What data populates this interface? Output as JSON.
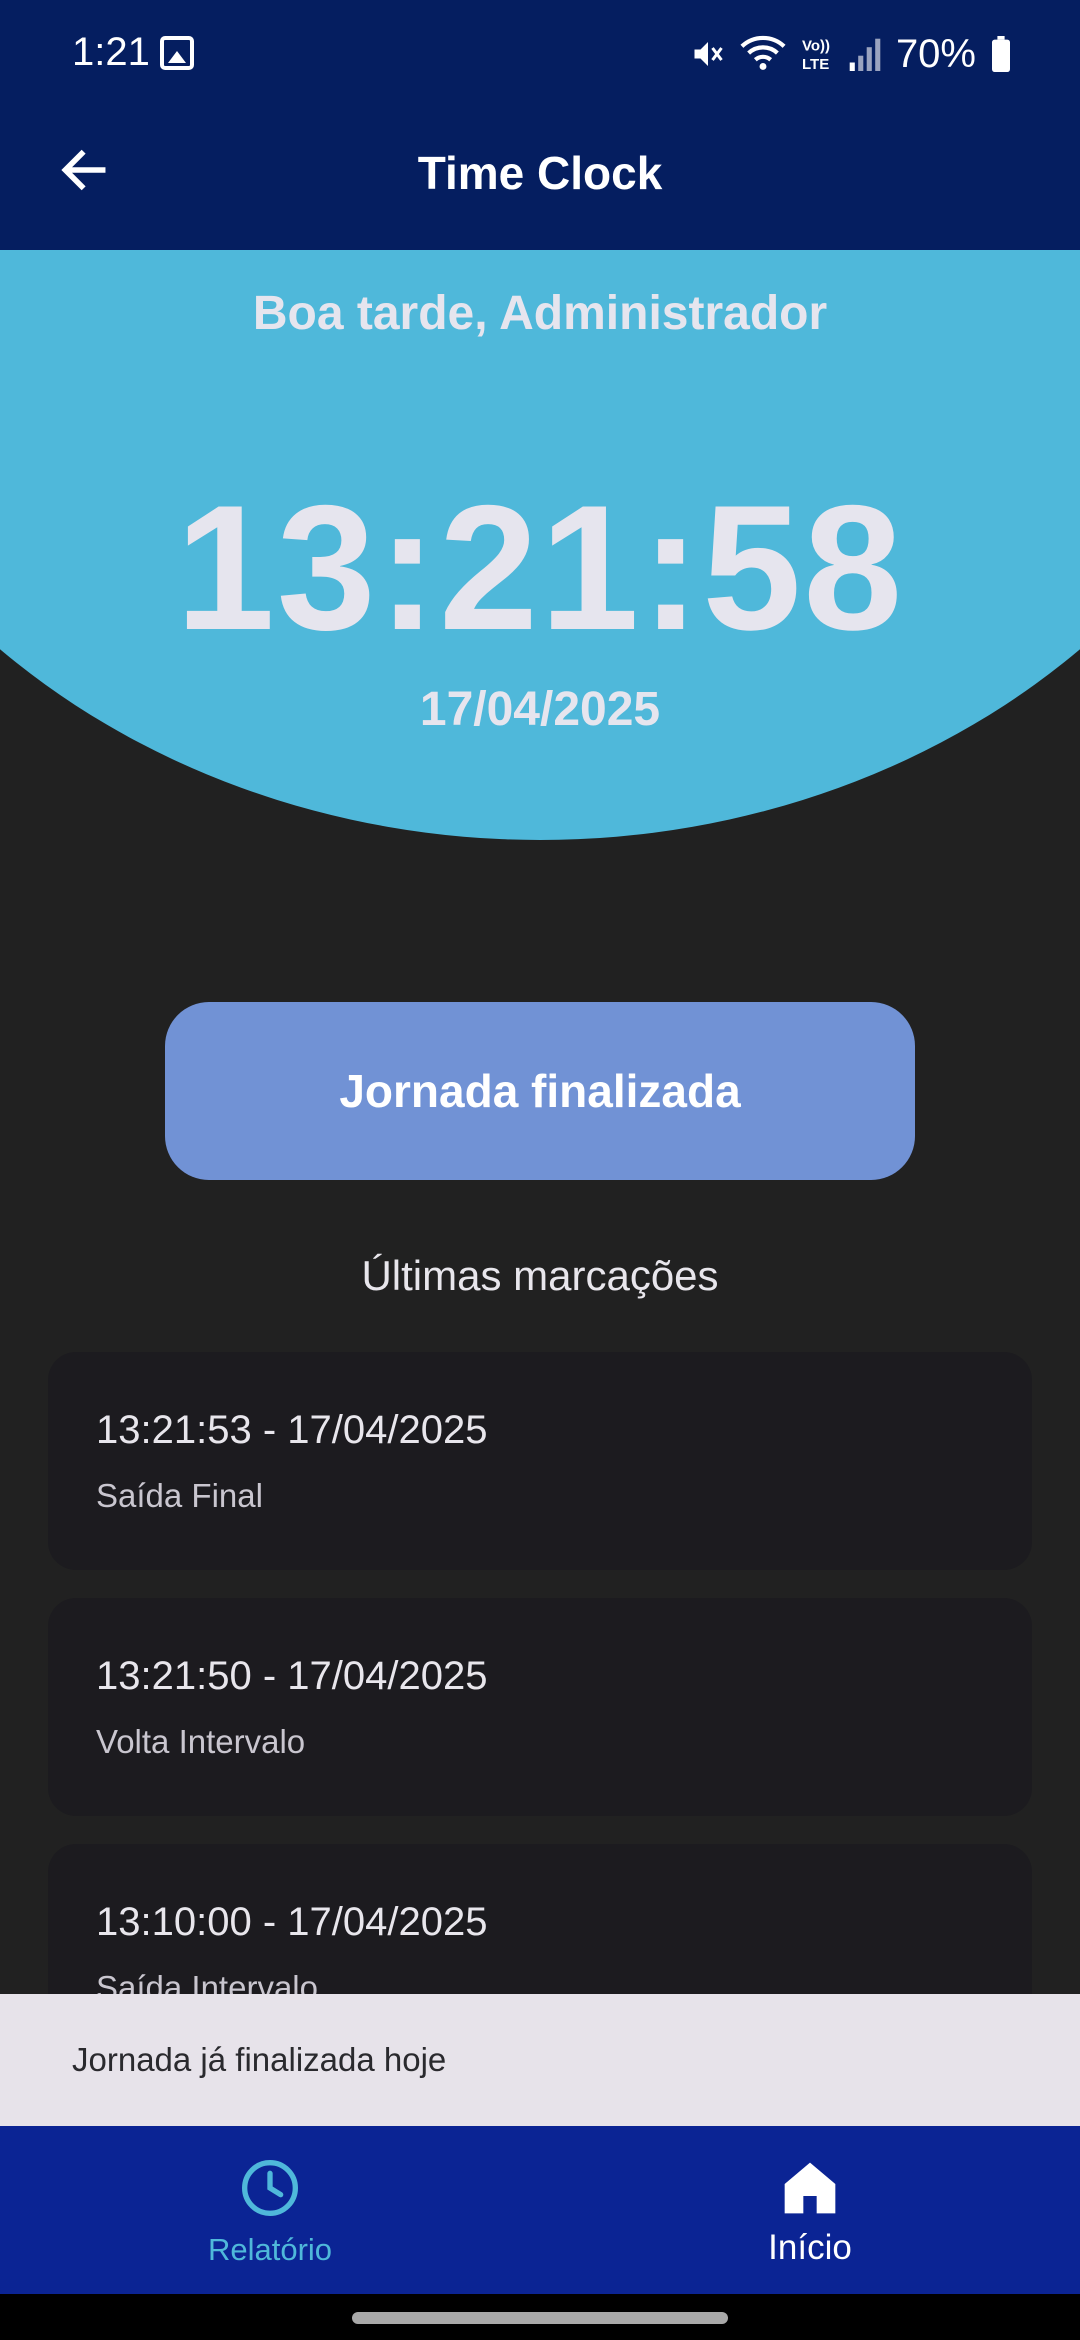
{
  "status_bar": {
    "time": "1:21",
    "battery_percent": "70%",
    "icons": [
      "gallery-icon",
      "mute-icon",
      "wifi-icon",
      "volte-icon",
      "signal-icon",
      "battery-icon"
    ]
  },
  "app_bar": {
    "title": "Time Clock",
    "back_icon": "arrow-back-icon"
  },
  "header": {
    "greeting": "Boa tarde, Administrador",
    "clock": "13:21:58",
    "date": "17/04/2025"
  },
  "main_button": {
    "label": "Jornada finalizada"
  },
  "records_section": {
    "title": "Últimas marcações",
    "items": [
      {
        "time": "13:21:53 - 17/04/2025",
        "type": "Saída Final"
      },
      {
        "time": "13:21:50 - 17/04/2025",
        "type": "Volta Intervalo"
      },
      {
        "time": "13:10:00 - 17/04/2025",
        "type": "Saída Intervalo"
      }
    ]
  },
  "snackbar": {
    "message": "Jornada já finalizada hoje"
  },
  "bottom_nav": {
    "items": [
      {
        "label": "Relatório",
        "icon": "clock-icon",
        "selected": false
      },
      {
        "label": "Início",
        "icon": "home-icon",
        "selected": true
      }
    ]
  },
  "colors": {
    "app_bar": "#051E60",
    "header_circle": "#4FB8DA",
    "button": "#7192D5",
    "background": "#212121",
    "card": "#1C1B1F",
    "bottom_nav": "#0B2494",
    "snackbar": "#E7E3EA"
  }
}
